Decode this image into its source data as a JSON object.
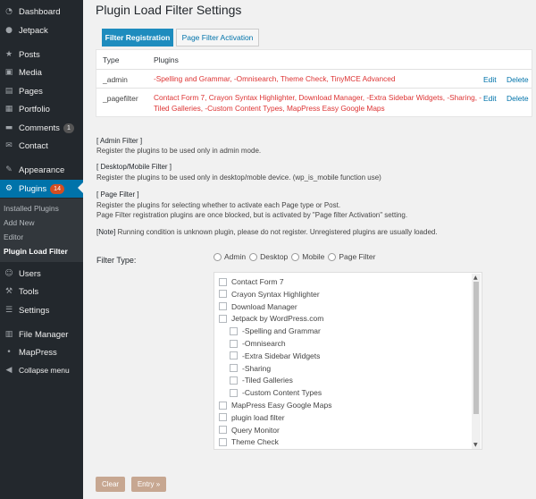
{
  "sidebar": {
    "items": [
      {
        "label": "Dashboard",
        "icon": "dashboard-icon",
        "glyph": "◔"
      },
      {
        "label": "Jetpack",
        "icon": "jetpack-icon",
        "glyph": "●"
      },
      {
        "label": "Posts",
        "icon": "pin-icon",
        "glyph": "★"
      },
      {
        "label": "Media",
        "icon": "media-icon",
        "glyph": "▣"
      },
      {
        "label": "Pages",
        "icon": "pages-icon",
        "glyph": "▤"
      },
      {
        "label": "Portfolio",
        "icon": "portfolio-icon",
        "glyph": "▦"
      },
      {
        "label": "Comments",
        "icon": "comments-icon",
        "glyph": "▬",
        "badge": "1"
      },
      {
        "label": "Contact",
        "icon": "contact-icon",
        "glyph": "✉"
      },
      {
        "label": "Appearance",
        "icon": "appearance-icon",
        "glyph": "✎"
      },
      {
        "label": "Plugins",
        "icon": "plugins-icon",
        "glyph": "⚙",
        "badge": "14"
      },
      {
        "label": "Users",
        "icon": "users-icon",
        "glyph": "☺"
      },
      {
        "label": "Tools",
        "icon": "tools-icon",
        "glyph": "⚒"
      },
      {
        "label": "Settings",
        "icon": "settings-icon",
        "glyph": "☰"
      },
      {
        "label": "File Manager",
        "icon": "file-manager-icon",
        "glyph": "▥"
      },
      {
        "label": "MapPress",
        "icon": "mappress-icon",
        "glyph": "•"
      },
      {
        "label": "Collapse menu",
        "icon": "collapse-icon",
        "glyph": "◀"
      }
    ],
    "submenu": [
      "Installed Plugins",
      "Add New",
      "Editor",
      "Plugin Load Filter"
    ]
  },
  "page": {
    "title": "Plugin Load Filter Settings"
  },
  "tabs": {
    "registration": "Filter Registration",
    "activation": "Page Filter Activation"
  },
  "table": {
    "headers": {
      "type": "Type",
      "plugins": "Plugins"
    },
    "rows": [
      {
        "type": "_admin",
        "plugins": "-Spelling and Grammar, -Omnisearch, Theme Check, TinyMCE Advanced",
        "edit": "Edit",
        "delete": "Delete"
      },
      {
        "type": "_pagefilter",
        "plugins": "Contact Form 7, Crayon Syntax Highlighter, Download Manager, -Extra Sidebar Widgets, -Sharing, -Tiled Galleries, -Custom Content Types, MapPress Easy Google Maps",
        "edit": "Edit",
        "delete": "Delete"
      }
    ]
  },
  "info": {
    "admin_title": "[ Admin Filter ]",
    "admin_desc": "Register the plugins to be used only in admin mode.",
    "desktop_title": "[ Desktop/Mobile Filter ]",
    "desktop_desc": "Register the plugins to be used only in desktop/moble device. (wp_is_mobile function use)",
    "page_title": "[ Page Filter ]",
    "page_desc1": "Register the plugins for selecting whether to activate each Page type or Post.",
    "page_desc2": "Page Filter registration plugins are once blocked, but is activated by \"Page filter Activation\" setting.",
    "note_label": "[Note]",
    "note_text": " Running condition is unknown plugin, please do not register. Unregistered plugins are usually loaded."
  },
  "filter": {
    "label": "Filter Type:",
    "options": [
      "Admin",
      "Desktop",
      "Mobile",
      "Page Filter"
    ]
  },
  "plugin_list": [
    {
      "label": "Contact Form 7",
      "indent": false
    },
    {
      "label": "Crayon Syntax Highlighter",
      "indent": false
    },
    {
      "label": "Download Manager",
      "indent": false
    },
    {
      "label": "Jetpack by WordPress.com",
      "indent": false
    },
    {
      "label": "-Spelling and Grammar",
      "indent": true
    },
    {
      "label": "-Omnisearch",
      "indent": true
    },
    {
      "label": "-Extra Sidebar Widgets",
      "indent": true
    },
    {
      "label": "-Sharing",
      "indent": true
    },
    {
      "label": "-Tiled Galleries",
      "indent": true
    },
    {
      "label": "-Custom Content Types",
      "indent": true
    },
    {
      "label": "MapPress Easy Google Maps",
      "indent": false
    },
    {
      "label": "plugin load filter",
      "indent": false
    },
    {
      "label": "Query Monitor",
      "indent": false
    },
    {
      "label": "Theme Check",
      "indent": false
    }
  ],
  "buttons": {
    "clear": "Clear",
    "entry": "Entry »"
  },
  "colors": {
    "sidebar": "#23282d",
    "accent": "#0073aa",
    "plugin_text": "#dd3333",
    "button": "#c7a791"
  }
}
